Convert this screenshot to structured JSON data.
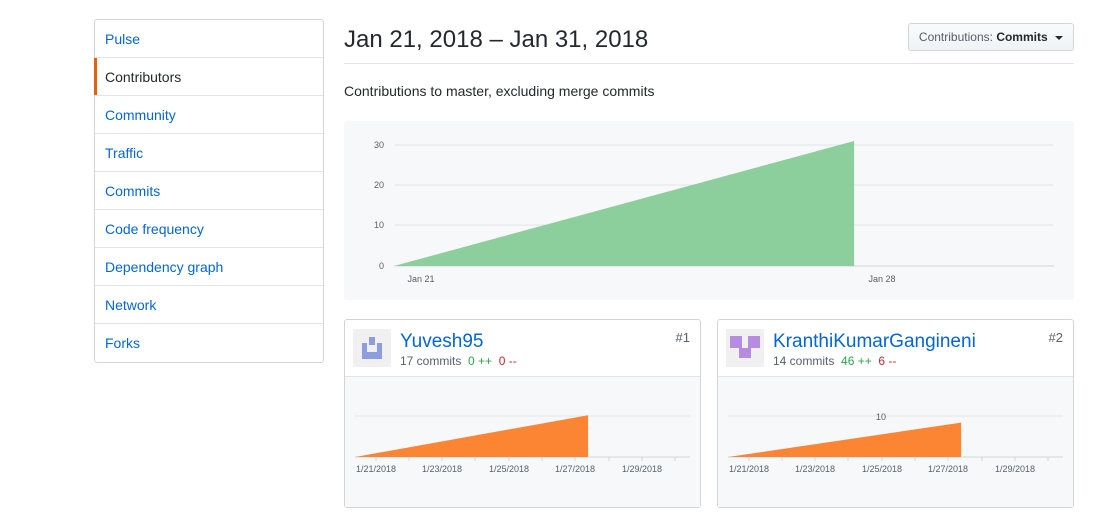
{
  "sidebar": {
    "items": [
      {
        "label": "Pulse"
      },
      {
        "label": "Contributors",
        "selected": true
      },
      {
        "label": "Community"
      },
      {
        "label": "Traffic"
      },
      {
        "label": "Commits"
      },
      {
        "label": "Code frequency"
      },
      {
        "label": "Dependency graph"
      },
      {
        "label": "Network"
      },
      {
        "label": "Forks"
      }
    ]
  },
  "header": {
    "title": "Jan 21, 2018 – Jan 31, 2018",
    "dropdown_prefix": "Contributions:",
    "dropdown_value": "Commits"
  },
  "subtitle": "Contributions to master, excluding merge commits",
  "colors": {
    "main_area": "#8cce9c",
    "contributor_area": "#fb8532",
    "link": "#0366d6",
    "selected_marker": "#e36209"
  },
  "chart_data": [
    {
      "type": "area",
      "title": "",
      "x": [
        "Jan 21",
        "Jan 27"
      ],
      "series": [
        {
          "values": [
            0,
            31
          ]
        }
      ],
      "x_tick_labels": [
        "Jan 21",
        "Jan 28"
      ],
      "y_ticks": [
        0,
        10,
        20,
        30
      ],
      "ylim": [
        0,
        30
      ],
      "grid": true
    },
    {
      "type": "area",
      "title": "",
      "x": [
        "1/21/2018",
        "1/27/2018"
      ],
      "series": [
        {
          "values": [
            0,
            17
          ]
        }
      ],
      "x_tick_labels": [
        "1/21/2018",
        "1/23/2018",
        "1/25/2018",
        "1/27/2018",
        "1/29/2018"
      ],
      "grid": true
    },
    {
      "type": "area",
      "title": "",
      "x": [
        "1/21/2018",
        "1/27/2018"
      ],
      "series": [
        {
          "values": [
            0,
            14
          ]
        }
      ],
      "x_tick_labels": [
        "1/21/2018",
        "1/23/2018",
        "1/25/2018",
        "1/27/2018",
        "1/29/2018"
      ],
      "y_tick_labels": [
        "10"
      ],
      "grid": true
    }
  ],
  "contributors": [
    {
      "username": "Yuvesh95",
      "commits": "17 commits",
      "additions": "0 ++",
      "deletions": "0 --",
      "rank": "#1",
      "avatar_icon": "identicon-icon"
    },
    {
      "username": "KranthiKumarGangineni",
      "commits": "14 commits",
      "additions": "46 ++",
      "deletions": "6 --",
      "rank": "#2",
      "avatar_icon": "identicon-icon"
    }
  ]
}
